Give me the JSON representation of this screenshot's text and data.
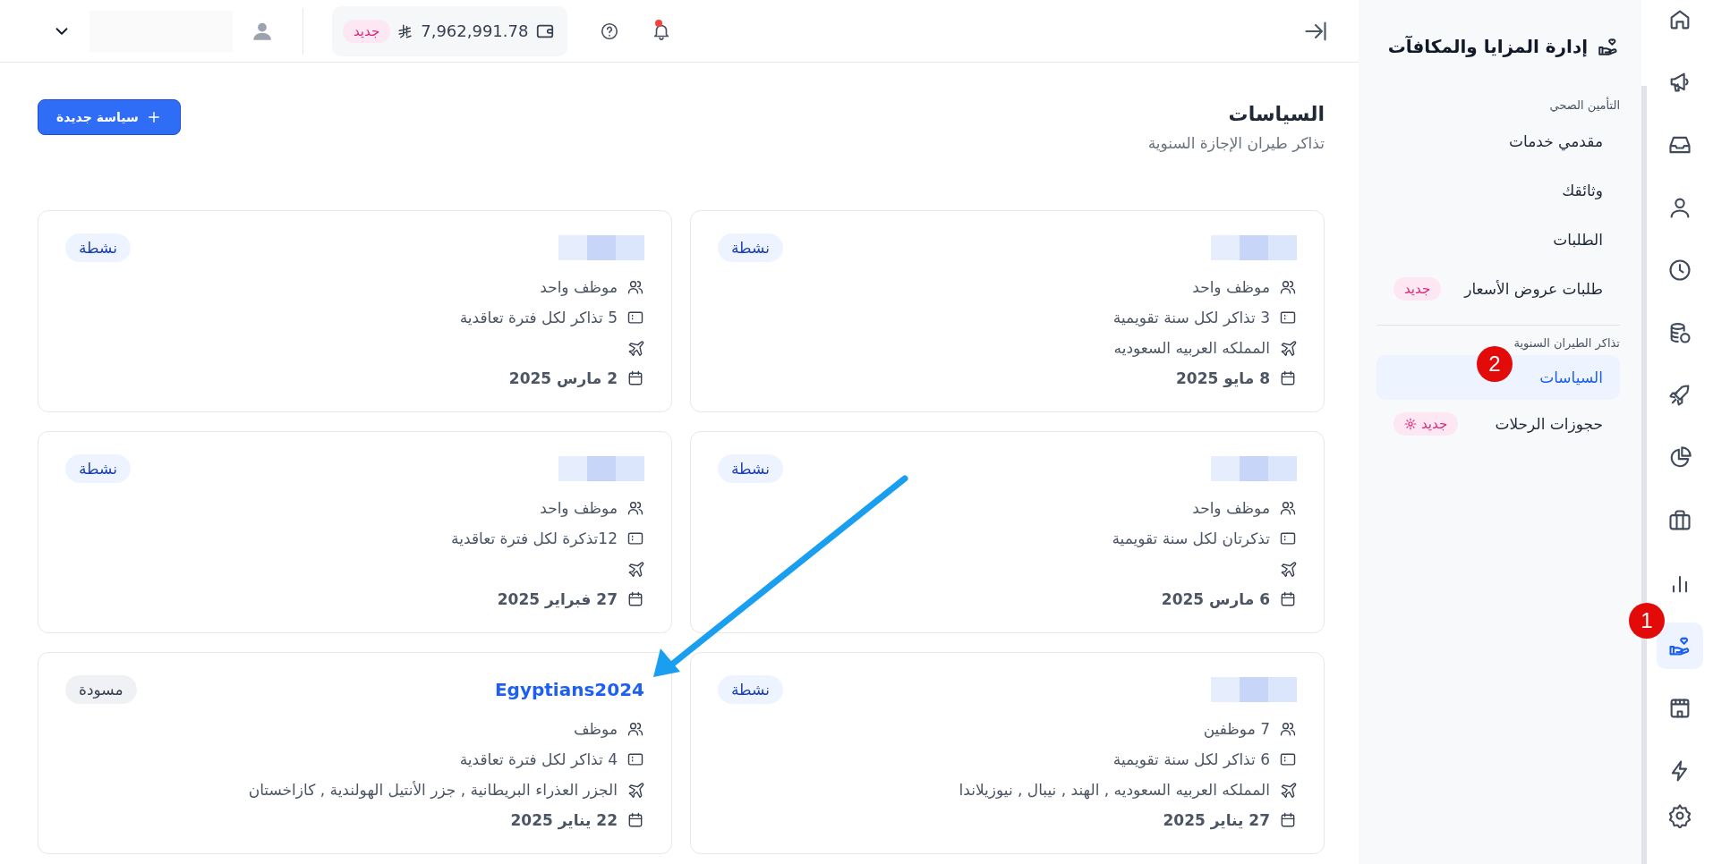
{
  "topbar": {
    "balance": "7,962,991.78",
    "balance_badge": "جديد",
    "notification_dot": true
  },
  "rail": [
    {
      "kind": "home",
      "selected": false
    },
    {
      "kind": "megaphone",
      "selected": false
    },
    {
      "kind": "inbox",
      "selected": false
    },
    {
      "kind": "user",
      "selected": false
    },
    {
      "kind": "clock",
      "selected": false
    },
    {
      "kind": "coins",
      "selected": false
    },
    {
      "kind": "rocket",
      "selected": false
    },
    {
      "kind": "pie",
      "selected": false
    },
    {
      "kind": "briefcase",
      "selected": false
    },
    {
      "kind": "chart",
      "selected": false
    },
    {
      "kind": "handheart",
      "selected": true
    },
    {
      "kind": "store",
      "selected": false
    },
    {
      "kind": "bolt",
      "selected": false
    },
    {
      "kind": "gear",
      "selected": false
    }
  ],
  "sidebar": {
    "title": "إدارة المزايا والمكافآت",
    "sections": [
      {
        "label": "التأمين الصحي",
        "items": [
          {
            "label": "مقدمي خدمات",
            "selected": false
          },
          {
            "label": "وثائقك",
            "selected": false
          },
          {
            "label": "الطلبات",
            "selected": false
          },
          {
            "label": "طلبات عروض الأسعار",
            "selected": false,
            "badge": "جديد",
            "badge_icon": false
          }
        ]
      },
      {
        "label": "تذاكر الطيران السنوية",
        "items": [
          {
            "label": "السياسات",
            "selected": true
          },
          {
            "label": "حجوزات الرحلات",
            "selected": false,
            "badge": "جديد",
            "badge_icon": true
          }
        ]
      }
    ]
  },
  "page": {
    "title": "السياسات",
    "subtitle": "تذاكر طيران الإجازة السنوية",
    "new_button": "سياسة جديدة"
  },
  "cards": [
    {
      "status": {
        "kind": "active",
        "label": "نشطة"
      },
      "employees": "موظف واحد",
      "tickets": "3 تذاكر لكل سنة تقويمية",
      "destinations": "المملكه العربيه السعوديه",
      "date": "8 مايو 2025"
    },
    {
      "status": {
        "kind": "active",
        "label": "نشطة"
      },
      "employees": "موظف واحد",
      "tickets": "5 تذاكر لكل فترة تعاقدية",
      "date": "2 مارس 2025"
    },
    {
      "status": {
        "kind": "active",
        "label": "نشطة"
      },
      "employees": "موظف واحد",
      "tickets": "تذكرتان لكل سنة تقويمية",
      "date": "6 مارس 2025"
    },
    {
      "status": {
        "kind": "active",
        "label": "نشطة"
      },
      "employees": "موظف واحد",
      "tickets": "12تذكرة لكل فترة تعاقدية",
      "date": "27 فبراير 2025"
    },
    {
      "status": {
        "kind": "active",
        "label": "نشطة"
      },
      "employees": "7 موظفين",
      "tickets": "6 تذاكر لكل سنة تقويمية",
      "destinations": "المملكه العربيه السعوديه , الهند , نيبال , نيوزيلاندا",
      "date": "27 يناير 2025"
    },
    {
      "title": "Egyptians2024",
      "status": {
        "kind": "draft",
        "label": "مسودة"
      },
      "employees": "موظف",
      "tickets": "4 تذاكر لكل فترة تعاقدية",
      "destinations": "الجزر العذراء البريطانية , جزر الأنتيل الهولندية , كازاخستان",
      "date": "22 يناير 2025"
    }
  ],
  "annotations": [
    {
      "label": "1"
    },
    {
      "label": "2"
    }
  ]
}
